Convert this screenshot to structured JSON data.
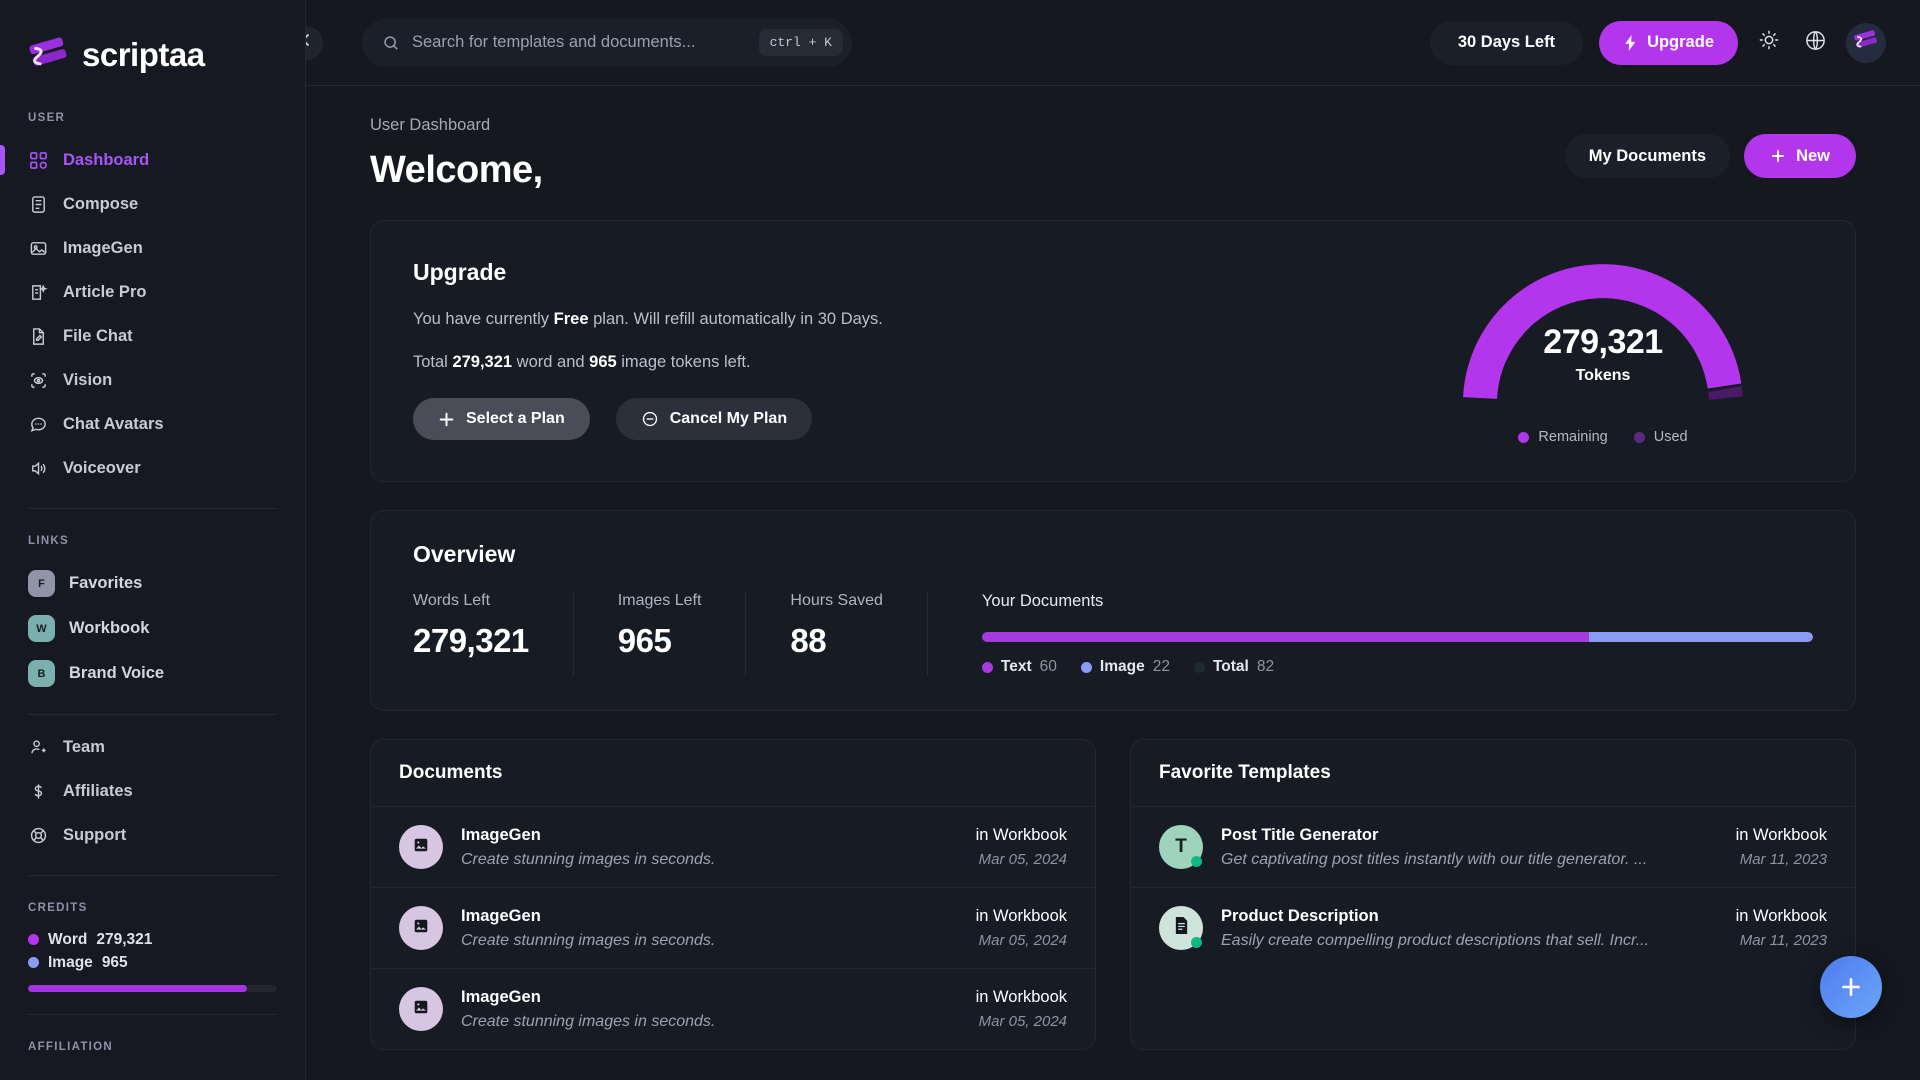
{
  "brand": {
    "name": "scriptaa",
    "logo_icon": "scriptaa-logo-icon"
  },
  "sidebar": {
    "user_section_label": "USER",
    "links_section_label": "LINKS",
    "credits_section_label": "CREDITS",
    "affiliation_section_label": "AFFILIATION",
    "nav": [
      {
        "label": "Dashboard",
        "icon": "grid-icon",
        "active": true
      },
      {
        "label": "Compose",
        "icon": "document-lines-icon",
        "active": false
      },
      {
        "label": "ImageGen",
        "icon": "image-icon",
        "active": false
      },
      {
        "label": "Article Pro",
        "icon": "article-sparkle-icon",
        "active": false
      },
      {
        "label": "File Chat",
        "icon": "file-pen-icon",
        "active": false
      },
      {
        "label": "Vision",
        "icon": "eye-scan-icon",
        "active": false
      },
      {
        "label": "Chat Avatars",
        "icon": "chat-bubble-icon",
        "active": false
      },
      {
        "label": "Voiceover",
        "icon": "speaker-wave-icon",
        "active": false
      }
    ],
    "links": [
      {
        "label": "Favorites",
        "chip": "F",
        "chip_color": "#8f94a6"
      },
      {
        "label": "Workbook",
        "chip": "W",
        "chip_color": "#79b0ae"
      },
      {
        "label": "Brand Voice",
        "chip": "B",
        "chip_color": "#79b0ae"
      }
    ],
    "utility": [
      {
        "label": "Team",
        "icon": "user-plus-icon"
      },
      {
        "label": "Affiliates",
        "icon": "dollar-icon"
      },
      {
        "label": "Support",
        "icon": "lifebuoy-icon"
      }
    ],
    "credits": {
      "word_label": "Word",
      "word_value": "279,321",
      "word_color": "#b436ec",
      "image_label": "Image",
      "image_value": "965",
      "image_color": "#8b9bf5",
      "bar_percent": 88
    }
  },
  "topbar": {
    "collapse_icon": "chevron-left-icon",
    "search": {
      "placeholder": "Search for templates and documents...",
      "value": "",
      "icon": "search-icon",
      "shortcut": "ctrl + K"
    },
    "days_left": "30 Days Left",
    "upgrade_label": "Upgrade",
    "upgrade_icon": "lightning-bolt-icon",
    "theme_icon": "sun-icon",
    "language_icon": "globe-icon",
    "avatar_icon": "scriptaa-avatar-icon"
  },
  "page": {
    "breadcrumb": "User Dashboard",
    "title": "Welcome,",
    "my_documents_label": "My Documents",
    "new_label": "New",
    "new_icon": "plus-icon"
  },
  "upgrade_card": {
    "title": "Upgrade",
    "plan_line_prefix": "You have currently ",
    "plan_name": "Free",
    "plan_line_suffix": " plan. Will refill automatically in 30 Days.",
    "tokens_prefix": "Total ",
    "words": "279,321",
    "tokens_mid": " word and ",
    "images": "965",
    "tokens_suffix": " image tokens left.",
    "select_plan_label": "Select a Plan",
    "select_plan_icon": "plus-icon",
    "cancel_plan_label": "Cancel My Plan",
    "cancel_plan_icon": "minus-circle-icon"
  },
  "overview": {
    "title": "Overview",
    "stats": [
      {
        "label": "Words Left",
        "value": "279,321"
      },
      {
        "label": "Images Left",
        "value": "965"
      },
      {
        "label": "Hours Saved",
        "value": "88"
      }
    ],
    "documents_chart_title": "Your Documents"
  },
  "documents_panel": {
    "title": "Documents",
    "rows": [
      {
        "title": "ImageGen",
        "desc": "Create stunning images in seconds.",
        "workbook": "in Workbook",
        "date": "Mar 05, 2024",
        "avatar_icon": "image-icon",
        "avatar_color": "#d6c6e2"
      },
      {
        "title": "ImageGen",
        "desc": "Create stunning images in seconds.",
        "workbook": "in Workbook",
        "date": "Mar 05, 2024",
        "avatar_icon": "image-icon",
        "avatar_color": "#d6c6e2"
      },
      {
        "title": "ImageGen",
        "desc": "Create stunning images in seconds.",
        "workbook": "in Workbook",
        "date": "Mar 05, 2024",
        "avatar_icon": "image-icon",
        "avatar_color": "#d6c6e2"
      }
    ]
  },
  "templates_panel": {
    "title": "Favorite Templates",
    "rows": [
      {
        "title": "Post Title Generator",
        "desc": "Get captivating post titles instantly with our title generator. ...",
        "workbook": "in Workbook",
        "date": "Mar 11, 2023",
        "avatar_letter": "T",
        "avatar_icon": "letter-t-icon",
        "avatar_color": "#9fd4bc"
      },
      {
        "title": "Product Description",
        "desc": "Easily create compelling product descriptions that sell. Incr...",
        "workbook": "in Workbook",
        "date": "Mar 11, 2023",
        "avatar_letter": "",
        "avatar_icon": "document-icon",
        "avatar_color": "#cfe3dd"
      }
    ]
  },
  "fab": {
    "icon": "plus-icon"
  },
  "chart_data": [
    {
      "type": "pie",
      "name": "tokens-gauge",
      "subtype": "semicircle-donut-gauge",
      "title": "279,321",
      "subtitle": "Tokens",
      "categories": [
        "Remaining",
        "Used"
      ],
      "values": [
        98.5,
        1.5
      ],
      "colors": [
        "#b436ec",
        "#4a1a66"
      ],
      "legend": [
        "Remaining",
        "Used"
      ],
      "legend_position": "bottom",
      "center_value": "279,321",
      "center_label": "Tokens"
    },
    {
      "type": "bar",
      "name": "your-documents-stacked-bar",
      "subtype": "horizontal-stacked",
      "title": "Your Documents",
      "categories": [
        "Text",
        "Image",
        "Total"
      ],
      "values": [
        60,
        22,
        82
      ],
      "colors": [
        "#a43ae0",
        "#8b9bf5",
        "#1f2a2c"
      ],
      "legend": [
        "Text 60",
        "Image 22",
        "Total 82"
      ],
      "legend_position": "bottom",
      "series": [
        {
          "name": "Text",
          "values": [
            60
          ],
          "color": "#a43ae0"
        },
        {
          "name": "Image",
          "values": [
            22
          ],
          "color": "#8b9bf5"
        },
        {
          "name": "Total",
          "values": [
            82
          ],
          "color": "#1f2a2c"
        }
      ],
      "stack_percent": [
        73,
        27
      ]
    },
    {
      "type": "bar",
      "name": "sidebar-credits-bar",
      "subtype": "progress",
      "categories": [
        "Word"
      ],
      "values": [
        279321
      ],
      "colors": [
        "#a435e0"
      ],
      "fill_percent": 88
    }
  ]
}
